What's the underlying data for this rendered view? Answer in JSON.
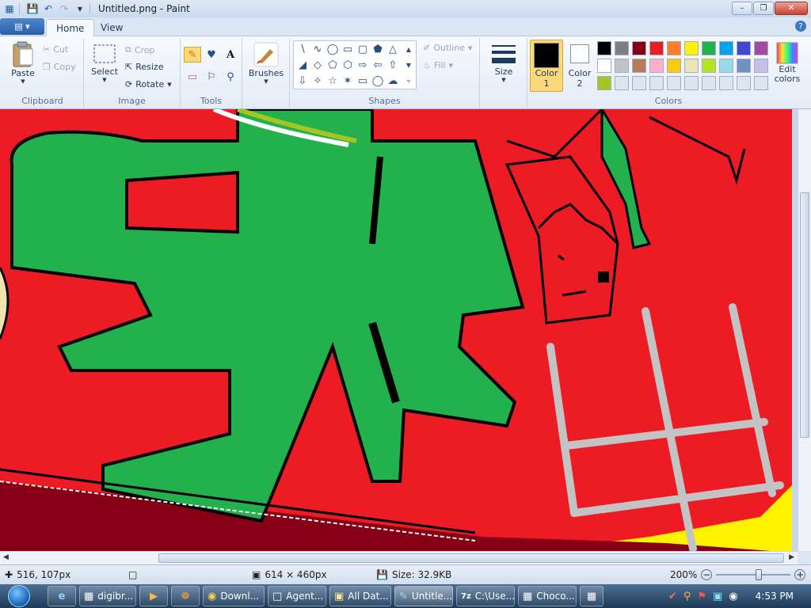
{
  "window": {
    "title": "Untitled.png - Paint",
    "controls": {
      "minimize": "–",
      "maximize": "❐",
      "close": "✕"
    }
  },
  "tabs": [
    {
      "label": "Home",
      "active": true
    },
    {
      "label": "View",
      "active": false
    }
  ],
  "ribbon": {
    "clipboard": {
      "label": "Clipboard",
      "paste": "Paste",
      "cut": "Cut",
      "copy": "Copy"
    },
    "image": {
      "label": "Image",
      "select": "Select",
      "crop": "Crop",
      "resize": "Resize",
      "rotate": "Rotate"
    },
    "tools": {
      "label": "Tools"
    },
    "brushes": {
      "label": "Brushes"
    },
    "shapes": {
      "label": "Shapes",
      "outline": "Outline",
      "fill": "Fill"
    },
    "size": {
      "label": "Size"
    },
    "colors": {
      "label": "Colors",
      "color1": {
        "label": "Color",
        "sub": "1",
        "value": "#000000"
      },
      "color2": {
        "label": "Color",
        "sub": "2",
        "value": "#ffffff"
      },
      "edit": "Edit colors",
      "palette_row1": [
        "#000000",
        "#7f7f7f",
        "#880015",
        "#ed1c24",
        "#ff7f27",
        "#fff200",
        "#22b14c",
        "#00a2e8",
        "#3f48cc",
        "#a349a4"
      ],
      "palette_row2": [
        "#ffffff",
        "#c3c3c3",
        "#b97a57",
        "#ffaec9",
        "#ffc90e",
        "#efe4b0",
        "#b5e61d",
        "#99d9ea",
        "#7092be",
        "#c8bfe7"
      ],
      "palette_row3": [
        "#a6c520",
        "#dde6f0",
        "#dde6f0",
        "#dde6f0",
        "#dde6f0",
        "#dde6f0",
        "#dde6f0",
        "#dde6f0",
        "#dde6f0",
        "#dde6f0"
      ]
    }
  },
  "status": {
    "cursor_pos": "516, 107px",
    "selection_size": "",
    "image_size": "614 × 460px",
    "file_size": "Size: 32.9KB",
    "zoom": "200%",
    "zoom_level": 0.58
  },
  "taskbar": {
    "items": [
      {
        "label": "digibr...",
        "icon": "app-icon"
      },
      {
        "label": "Downl...",
        "icon": "chrome-icon"
      },
      {
        "label": "Agent...",
        "icon": "window-icon"
      },
      {
        "label": "All Dat...",
        "icon": "folder-icon"
      },
      {
        "label": "Untitle...",
        "icon": "paint-icon",
        "active": true
      },
      {
        "label": "C:\\Use...",
        "icon": "7zip-icon"
      },
      {
        "label": "Choco...",
        "icon": "app-icon"
      }
    ],
    "clock": "4:53 PM"
  }
}
